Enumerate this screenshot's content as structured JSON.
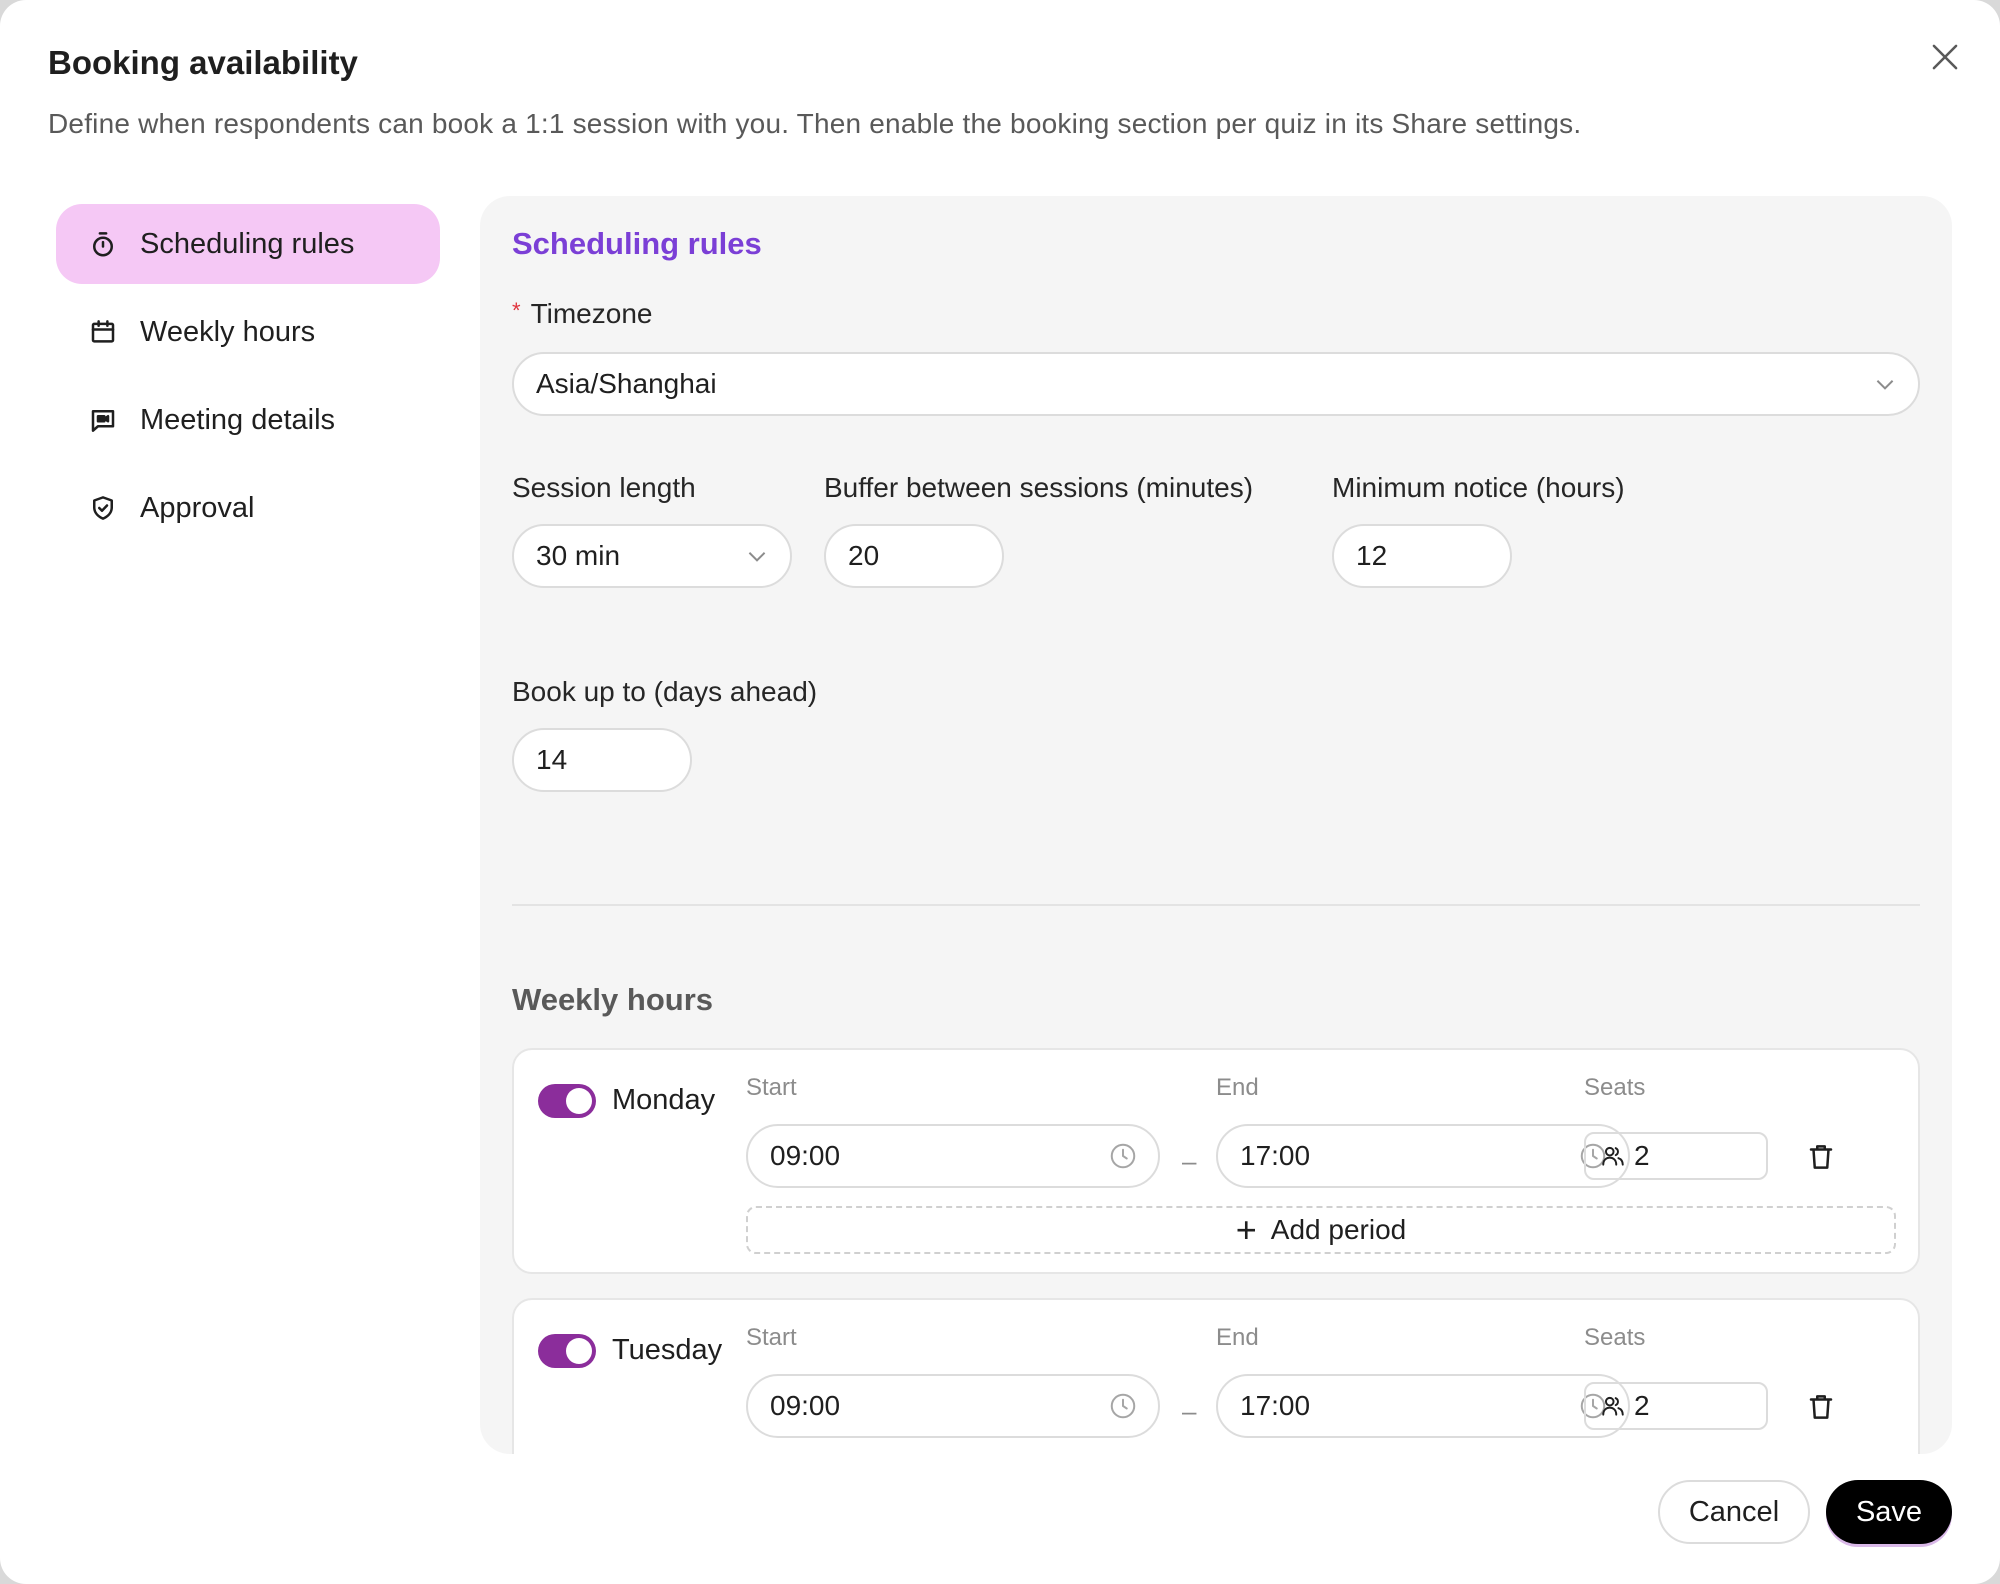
{
  "dialog": {
    "title": "Booking availability",
    "subtitle": "Define when respondents can book a 1:1 session with you. Then enable the booking section per quiz in its Share settings.",
    "close_icon": "close-icon"
  },
  "sidebar": {
    "items": [
      {
        "label": "Scheduling rules",
        "icon": "timer-icon",
        "active": true
      },
      {
        "label": "Weekly hours",
        "icon": "calendar-icon",
        "active": false
      },
      {
        "label": "Meeting details",
        "icon": "video-message-icon",
        "active": false
      },
      {
        "label": "Approval",
        "icon": "shield-check-icon",
        "active": false
      }
    ]
  },
  "scheduling": {
    "section_title": "Scheduling rules",
    "timezone": {
      "required_mark": "*",
      "label": "Timezone",
      "value": "Asia/Shanghai"
    },
    "session_length": {
      "label": "Session length",
      "value": "30 min"
    },
    "buffer": {
      "label": "Buffer between sessions (minutes)",
      "value": "20"
    },
    "min_notice": {
      "label": "Minimum notice (hours)",
      "value": "12"
    },
    "book_ahead": {
      "label": "Book up to (days ahead)",
      "value": "14"
    }
  },
  "weekly": {
    "section_title": "Weekly hours",
    "col_start": "Start",
    "col_end": "End",
    "col_seats": "Seats",
    "separator": "–",
    "add_period": "Add period",
    "days": [
      {
        "name": "Monday",
        "enabled": true,
        "start": "09:00",
        "end": "17:00",
        "seats": "2"
      },
      {
        "name": "Tuesday",
        "enabled": true,
        "start": "09:00",
        "end": "17:00",
        "seats": "2"
      }
    ]
  },
  "footer": {
    "cancel_label": "Cancel",
    "save_label": "Save"
  },
  "colors": {
    "accent_purple": "#7b3fd6",
    "active_nav_bg": "#f5c8f5",
    "toggle_on": "#8b2d9b",
    "save_bg": "#000000"
  }
}
